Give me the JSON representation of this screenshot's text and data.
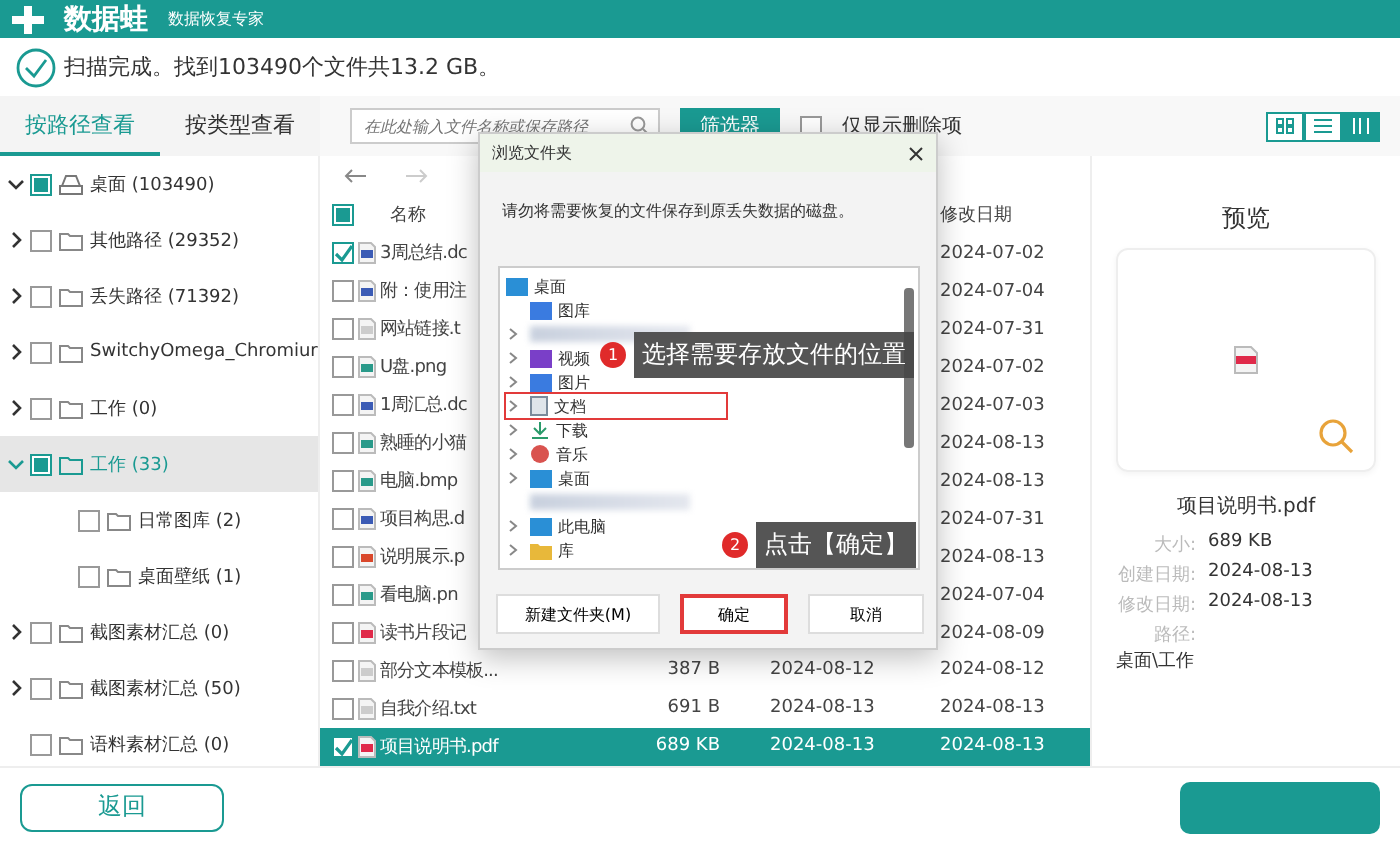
{
  "app": {
    "brand": "数据蛙",
    "subtitle": "数据恢复专家"
  },
  "status": {
    "text": "扫描完成。找到103490个文件共13.2 GB。"
  },
  "view_tabs": [
    {
      "label": "按路径查看",
      "selected": true
    },
    {
      "label": "按类型查看",
      "selected": false
    }
  ],
  "toolbar": {
    "search": {
      "placeholder": "在此处输入文件名称或保存路径"
    },
    "filter_button": "筛选器",
    "deleted_only": {
      "label": "仅显示删除项",
      "checked": false
    },
    "views": [
      {
        "kind": "grid",
        "selected": false
      },
      {
        "kind": "list",
        "selected": false
      },
      {
        "kind": "detail",
        "selected": true
      }
    ]
  },
  "tree": [
    {
      "label": "桌面 (103490)",
      "checked": true,
      "expanded": true,
      "selected": false,
      "kind": "drive",
      "children": [
        {
          "label": "其他路径 (29352)",
          "checked": false,
          "expanded": false,
          "selected": false,
          "kind": "folder"
        },
        {
          "label": "丢失路径 (71392)",
          "checked": false,
          "expanded": false,
          "selected": false,
          "kind": "folder"
        },
        {
          "label": "SwitchyOmega_Chromiur",
          "checked": false,
          "expanded": false,
          "selected": false,
          "kind": "folder"
        },
        {
          "label": "工作 (0)",
          "checked": false,
          "expanded": false,
          "selected": false,
          "kind": "folder"
        },
        {
          "label": "工作 (33)",
          "checked": true,
          "expanded": true,
          "selected": true,
          "kind": "folder",
          "children": [
            {
              "label": "日常图库 (2)",
              "checked": false,
              "selected": false,
              "kind": "folder"
            },
            {
              "label": "桌面壁纸 (1)",
              "checked": false,
              "selected": false,
              "kind": "folder"
            }
          ]
        },
        {
          "label": "截图素材汇总 (0)",
          "checked": false,
          "expanded": false,
          "selected": false,
          "kind": "folder"
        },
        {
          "label": "截图素材汇总 (50)",
          "checked": false,
          "expanded": false,
          "selected": false,
          "kind": "folder"
        },
        {
          "label": "语料素材汇总 (0)",
          "checked": false,
          "selected": false,
          "kind": "folder"
        }
      ]
    }
  ],
  "table": {
    "header_checked": true,
    "columns": [
      "名称",
      "修改日期"
    ],
    "rows": [
      {
        "name": "3周总结.dc",
        "kind": "doc",
        "checked": true,
        "selected": false,
        "modified": "2024-07-02"
      },
      {
        "name": "附：使用注",
        "kind": "doc",
        "checked": false,
        "selected": false,
        "modified": "2024-07-04"
      },
      {
        "name": "网站链接.t",
        "kind": "txt",
        "checked": false,
        "selected": false,
        "modified": "2024-07-31"
      },
      {
        "name": "U盘.png",
        "kind": "img",
        "checked": false,
        "selected": false,
        "modified": "2024-07-02"
      },
      {
        "name": "1周汇总.dc",
        "kind": "doc",
        "checked": false,
        "selected": false,
        "modified": "2024-07-03"
      },
      {
        "name": "熟睡的小猫",
        "kind": "img",
        "checked": false,
        "selected": false,
        "modified": "2024-08-13"
      },
      {
        "name": "电脑.bmp",
        "kind": "img",
        "checked": false,
        "selected": false,
        "modified": "2024-08-13"
      },
      {
        "name": "项目构思.d",
        "kind": "doc",
        "checked": false,
        "selected": false,
        "modified": "2024-07-31"
      },
      {
        "name": "说明展示.p",
        "kind": "ppt",
        "checked": false,
        "selected": false,
        "modified": "2024-08-13"
      },
      {
        "name": "看电脑.pn",
        "kind": "img",
        "checked": false,
        "selected": false,
        "modified": "2024-07-04"
      },
      {
        "name": "读书片段记",
        "kind": "pdf",
        "checked": false,
        "selected": false,
        "modified": "2024-08-09"
      },
      {
        "name": "部分文本模板...",
        "kind": "txt",
        "checked": false,
        "selected": false,
        "size": "387  B",
        "created": "2024-08-12",
        "modified": "2024-08-12"
      },
      {
        "name": "自我介绍.txt",
        "kind": "txt",
        "checked": false,
        "selected": false,
        "size": "691  B",
        "created": "2024-08-13",
        "modified": "2024-08-13"
      },
      {
        "name": "项目说明书.pdf",
        "kind": "pdf",
        "checked": true,
        "selected": true,
        "size": "689 KB",
        "created": "2024-08-13",
        "modified": "2024-08-13"
      }
    ]
  },
  "preview": {
    "title": "预览",
    "filename": "项目说明书.pdf",
    "fields": [
      {
        "label": "大小:",
        "value": "689 KB"
      },
      {
        "label": "创建日期:",
        "value": "2024-08-13"
      },
      {
        "label": "修改日期:",
        "value": "2024-08-13"
      },
      {
        "label": "路径:"
      }
    ],
    "path": "桌面\\工作"
  },
  "dialog": {
    "title": "浏览文件夹",
    "message": "请勿将需要恢复的文件保存到原丢失数据的磁盘。",
    "folders": [
      {
        "label": "桌面",
        "kind": "desktop",
        "children": [
          {
            "label": "图库",
            "kind": "gallery",
            "expandable": false,
            "highlighted": false
          },
          {
            "kind": "blurred",
            "expandable": true,
            "highlighted": false
          },
          {
            "label": "视频",
            "kind": "video",
            "expandable": true,
            "highlighted": false
          },
          {
            "label": "图片",
            "kind": "picture",
            "expandable": true,
            "highlighted": false
          },
          {
            "label": "文档",
            "kind": "document",
            "expandable": true,
            "highlighted": true
          },
          {
            "label": "下载",
            "kind": "download",
            "expandable": true,
            "highlighted": false
          },
          {
            "label": "音乐",
            "kind": "music",
            "expandable": true,
            "highlighted": false
          },
          {
            "label": "桌面",
            "kind": "desktop",
            "expandable": true,
            "highlighted": false
          },
          {
            "kind": "blurred",
            "expandable": false,
            "highlighted": false
          },
          {
            "label": "此电脑",
            "kind": "pc",
            "expandable": true,
            "highlighted": false
          },
          {
            "label": "库",
            "kind": "library",
            "expandable": true,
            "highlighted": false
          }
        ]
      }
    ],
    "buttons": [
      {
        "label": "新建文件夹(M)",
        "highlighted": false
      },
      {
        "label": "确定",
        "highlighted": true
      },
      {
        "label": "取消",
        "highlighted": false
      }
    ]
  },
  "callouts": [
    {
      "number": "1",
      "text": "选择需要存放文件的位置"
    },
    {
      "number": "2",
      "text": "点击【确定】"
    }
  ],
  "footer": {
    "back_button": "返回"
  }
}
